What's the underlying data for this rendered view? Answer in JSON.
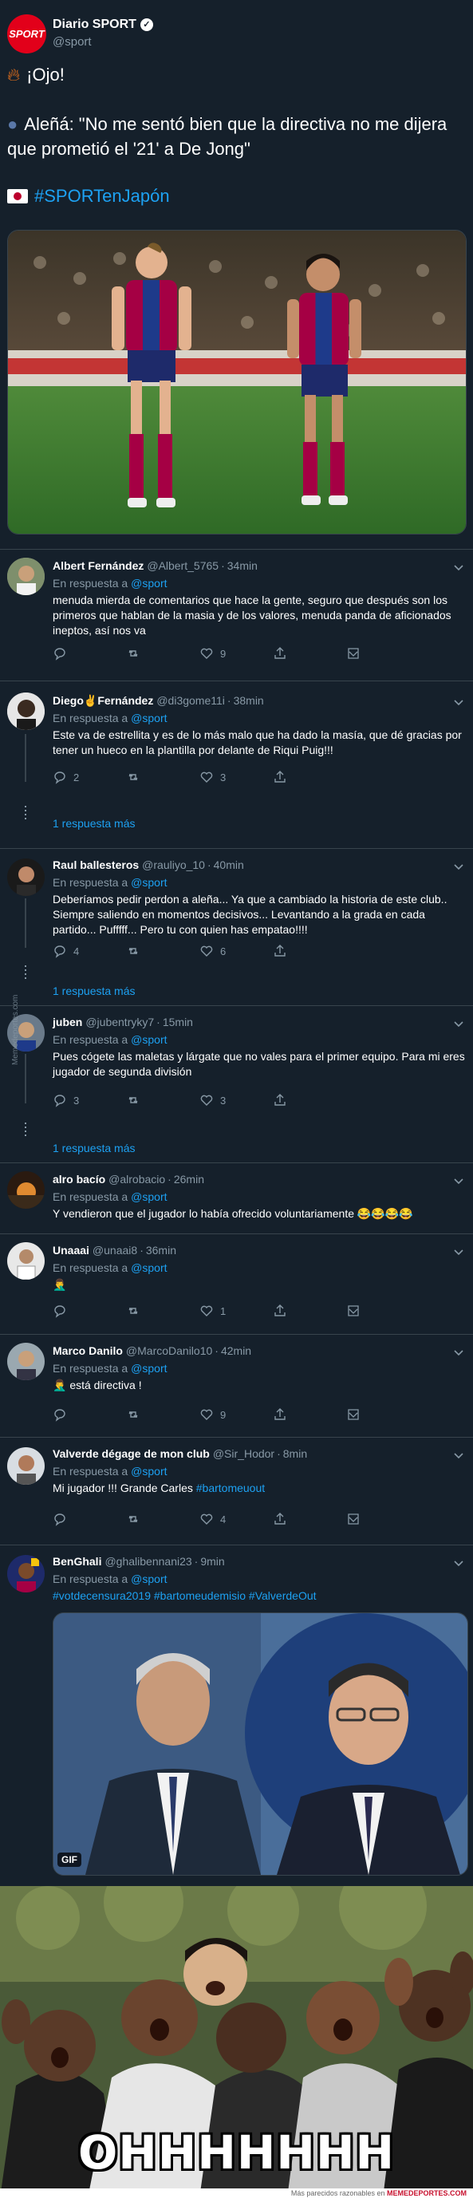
{
  "main_tweet": {
    "avatar_text": "SPORT",
    "name": "Diario SPORT",
    "handle": "@sport",
    "line1": "¡Ojo!",
    "line2": "Aleñá: \"No me sentó bien que la directiva no me dijera que prometió el '21' a De Jong\"",
    "hashtag": "#SPORTenJapón"
  },
  "reply_to_label": "En respuesta a",
  "reply_mention": "@sport",
  "more_replies_label": "1 respuesta más",
  "side_watermark": "Memedeportes.com",
  "replies": [
    {
      "name": "Albert Fernández",
      "handle": "@Albert_5765",
      "time": "34min",
      "text": "menuda mierda de comentarios que hace la gente, seguro que después son los primeros que hablan de la masia y de los valores, menuda panda de aficionados ineptos, así nos va",
      "replies": "",
      "retweets": "",
      "likes": "9"
    },
    {
      "name": "Diego✌Fernández",
      "handle": "@di3gome11i",
      "time": "38min",
      "text": "Este va de estrellita y es de lo más malo que ha dado la masía, que dé gracias por tener un hueco en la plantilla por delante de Riqui Puig!!!",
      "replies": "2",
      "retweets": "",
      "likes": "3"
    },
    {
      "name": "Raul ballesteros",
      "handle": "@rauliyo_10",
      "time": "40min",
      "text": "Deberíamos pedir perdon a aleña... Ya que a cambiado la historia de este club.. Siempre saliendo en momentos decisivos... Levantando a la grada en cada partido... Pufffff... Pero tu con quien has empatao!!!!",
      "replies": "4",
      "retweets": "",
      "likes": "6"
    },
    {
      "name": "juben",
      "handle": "@jubentryky7",
      "time": "15min",
      "text": "Pues cógete las maletas y lárgate que no vales para el primer equipo. Para mi eres jugador de segunda división",
      "replies": "3",
      "retweets": "",
      "likes": "3"
    },
    {
      "name": "alro bacío",
      "handle": "@alrobacio",
      "time": "26min",
      "text": "Y vendieron que el jugador lo había ofrecido voluntariamente 😂😂😂😂"
    },
    {
      "name": "Unaaai",
      "handle": "@unaai8",
      "time": "36min",
      "text": "🤦‍♂️",
      "replies": "",
      "retweets": "",
      "likes": "1"
    },
    {
      "name": "Marco Danilo",
      "handle": "@MarcoDanilo10",
      "time": "42min",
      "text": "🤦‍♂️ está directiva !",
      "replies": "",
      "retweets": "",
      "likes": "9"
    },
    {
      "name": "Valverde dégage de mon club",
      "handle": "@Sir_Hodor",
      "time": "8min",
      "text_prefix": "Mi jugador !!! Grande Carles ",
      "text_tag": "#bartomeuout",
      "replies": "",
      "retweets": "",
      "likes": "4"
    },
    {
      "name": "BenGhali",
      "handle": "@ghalibennani23",
      "time": "9min",
      "text": "#votdecensura2019 #bartomeudemisio #ValverdeOut",
      "gif_badge": "GIF"
    }
  ],
  "meme": {
    "caption": "OHHHHHHH",
    "credit_prefix": "Más parecidos razonables en",
    "credit_site": "MEMEDEPORTES.COM"
  },
  "colors": {
    "background": "#15202b",
    "link": "#1da1f2",
    "muted": "#8899a6",
    "divider": "#38444d"
  }
}
